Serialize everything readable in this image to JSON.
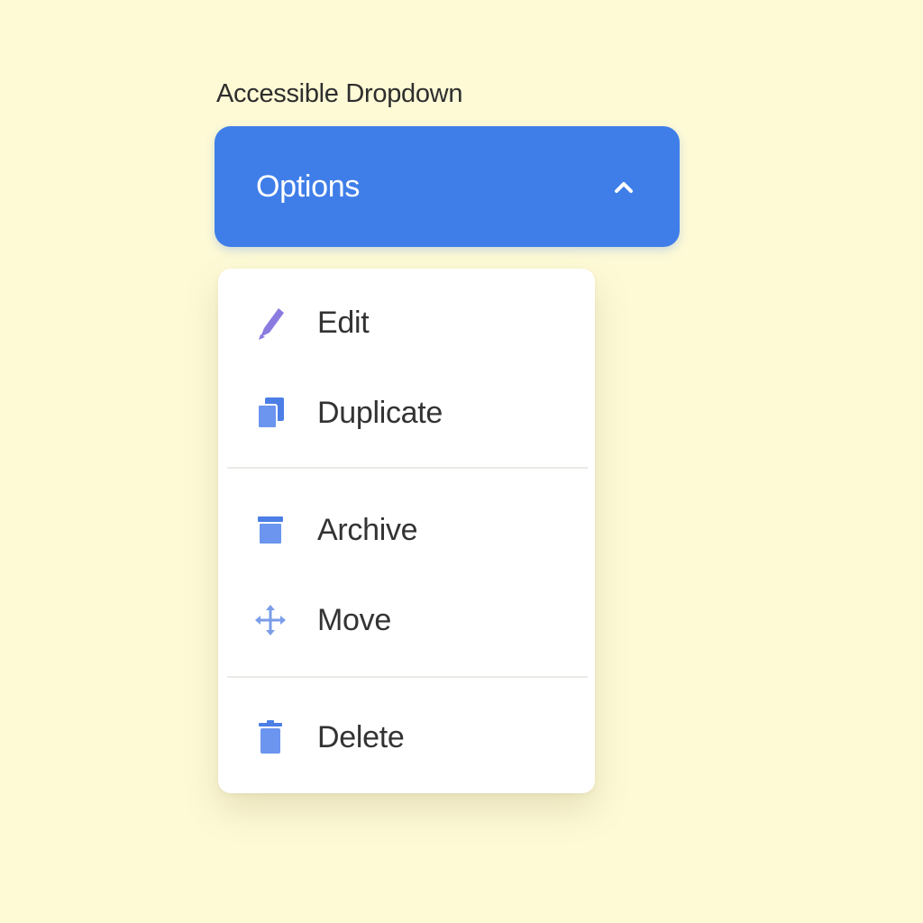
{
  "dropdown": {
    "label": "Accessible Dropdown",
    "trigger_label": "Options",
    "trigger_icon": "chevron-up-icon",
    "accent_color": "#3f7ee8",
    "expanded": true,
    "items": [
      {
        "label": "Edit",
        "icon": "pencil-icon"
      },
      {
        "label": "Duplicate",
        "icon": "copy-icon"
      },
      {
        "label": "Archive",
        "icon": "archive-icon"
      },
      {
        "label": "Move",
        "icon": "move-icon"
      },
      {
        "label": "Delete",
        "icon": "trash-icon"
      }
    ]
  }
}
